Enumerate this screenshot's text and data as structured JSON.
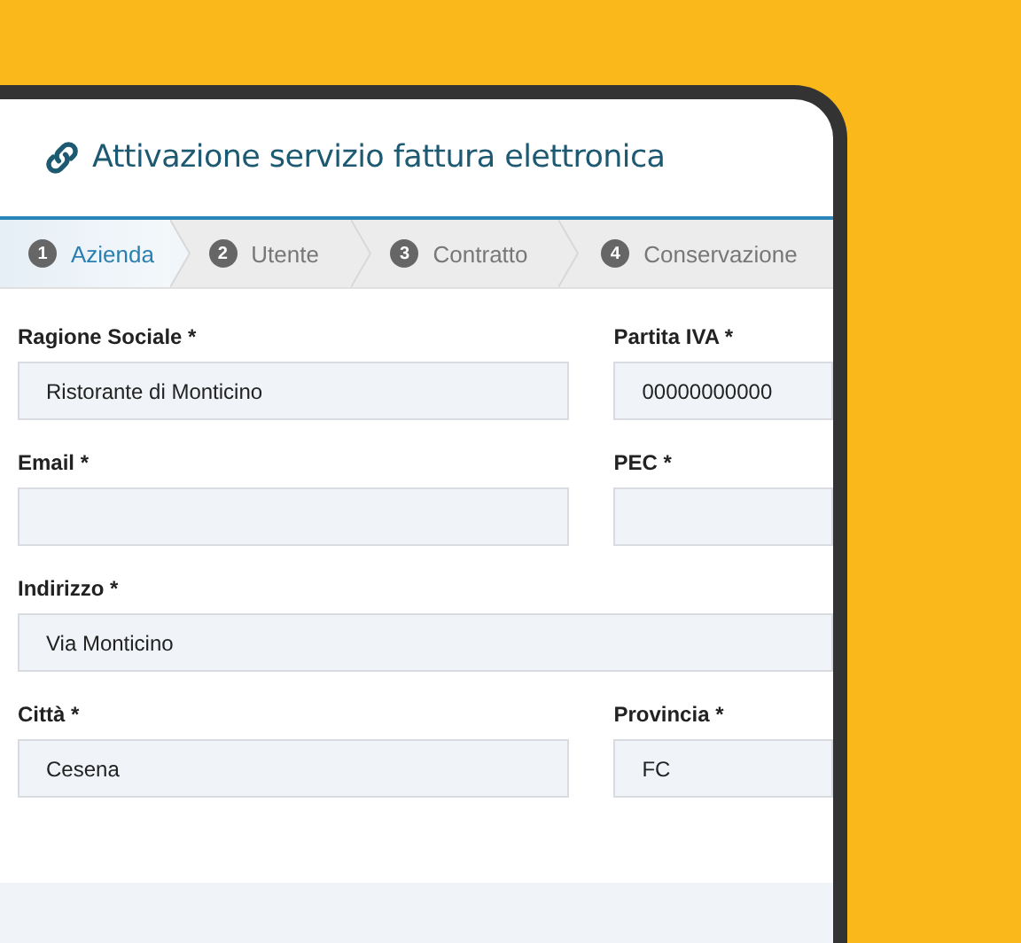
{
  "title": "Attivazione servizio fattura elettronica",
  "steps": [
    {
      "number": "1",
      "label": "Azienda",
      "selected": true
    },
    {
      "number": "2",
      "label": "Utente",
      "selected": false
    },
    {
      "number": "3",
      "label": "Contratto",
      "selected": false
    },
    {
      "number": "4",
      "label": "Conservazione",
      "selected": false
    }
  ],
  "form_rows": [
    [
      {
        "label": "Ragione Sociale *",
        "value": "Ristorante di Monticino"
      },
      {
        "label": "Partita IVA *",
        "value": "00000000000"
      }
    ],
    [
      {
        "label": "Email *"
      },
      {
        "label": "PEC *"
      }
    ],
    [
      {
        "label": "Indirizzo *",
        "value": "Via Monticino"
      }
    ],
    [
      {
        "label": "Città *",
        "value": "Cesena"
      },
      {
        "label": "Provincia *",
        "value": "FC"
      }
    ]
  ]
}
